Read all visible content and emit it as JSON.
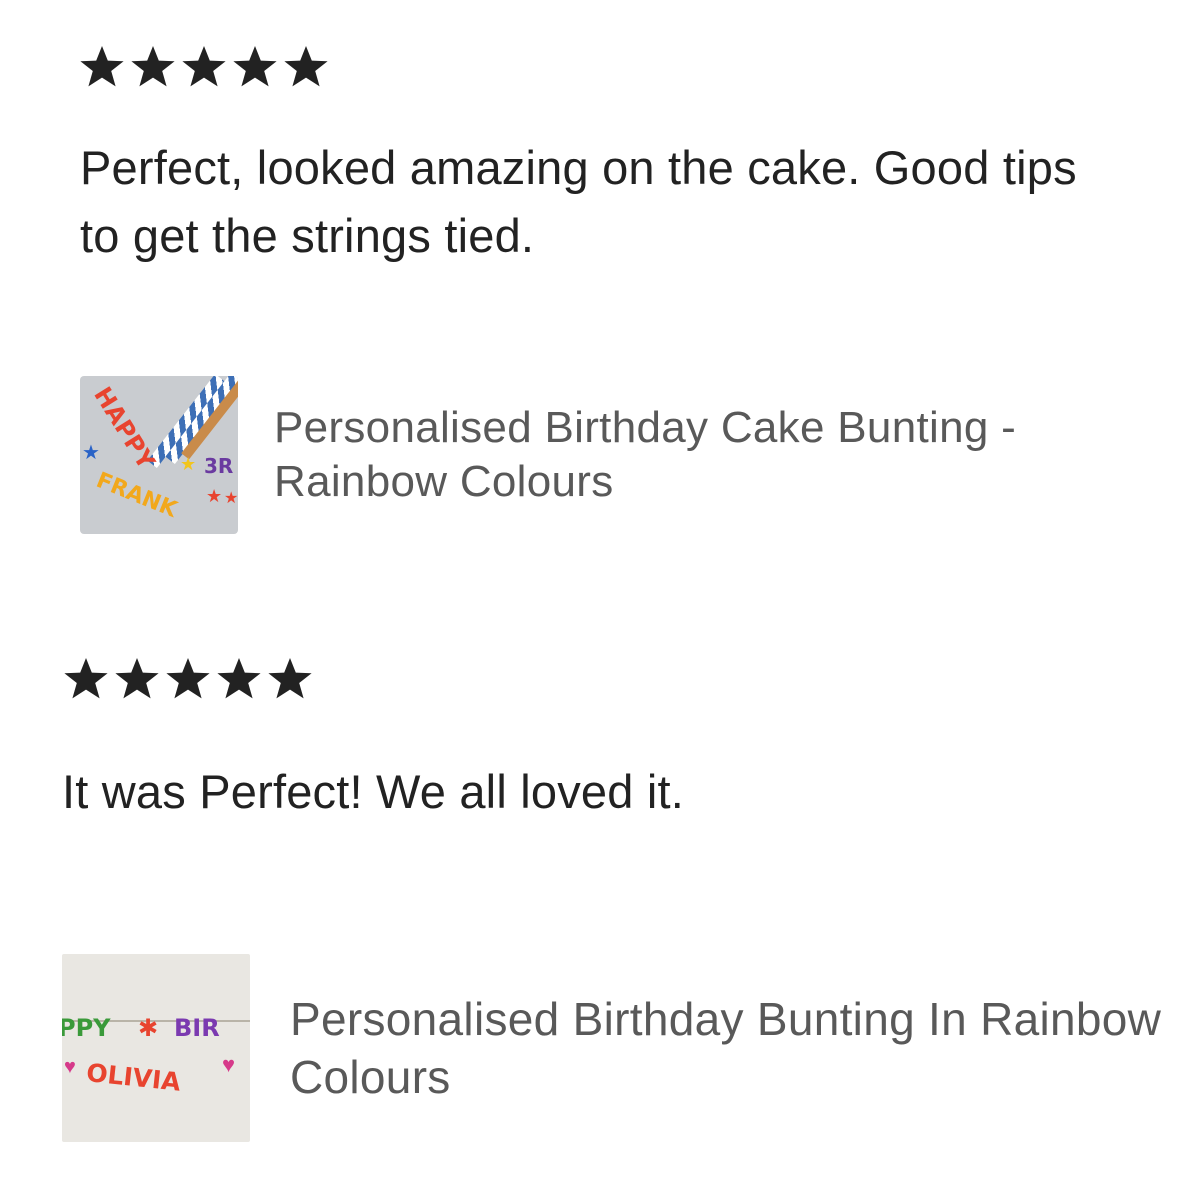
{
  "reviews": [
    {
      "rating": 5,
      "text": "Perfect, looked amazing on the cake. Good tips to get the strings tied.",
      "product": {
        "title": "Personalised Birthday Cake Bunting - Rainbow Colours",
        "thumbnail_text": [
          "HAPPY",
          "3R",
          "FRANK"
        ]
      }
    },
    {
      "rating": 5,
      "text": "It was Perfect! We all loved it.",
      "product": {
        "title": "Personalised Birthday Bunting In Rainbow Colours",
        "thumbnail_text": [
          "PPY",
          "BIR",
          "OLIVIA"
        ]
      }
    }
  ],
  "colors": {
    "star": "#222222",
    "text": "#222222",
    "product_title": "#595959"
  }
}
